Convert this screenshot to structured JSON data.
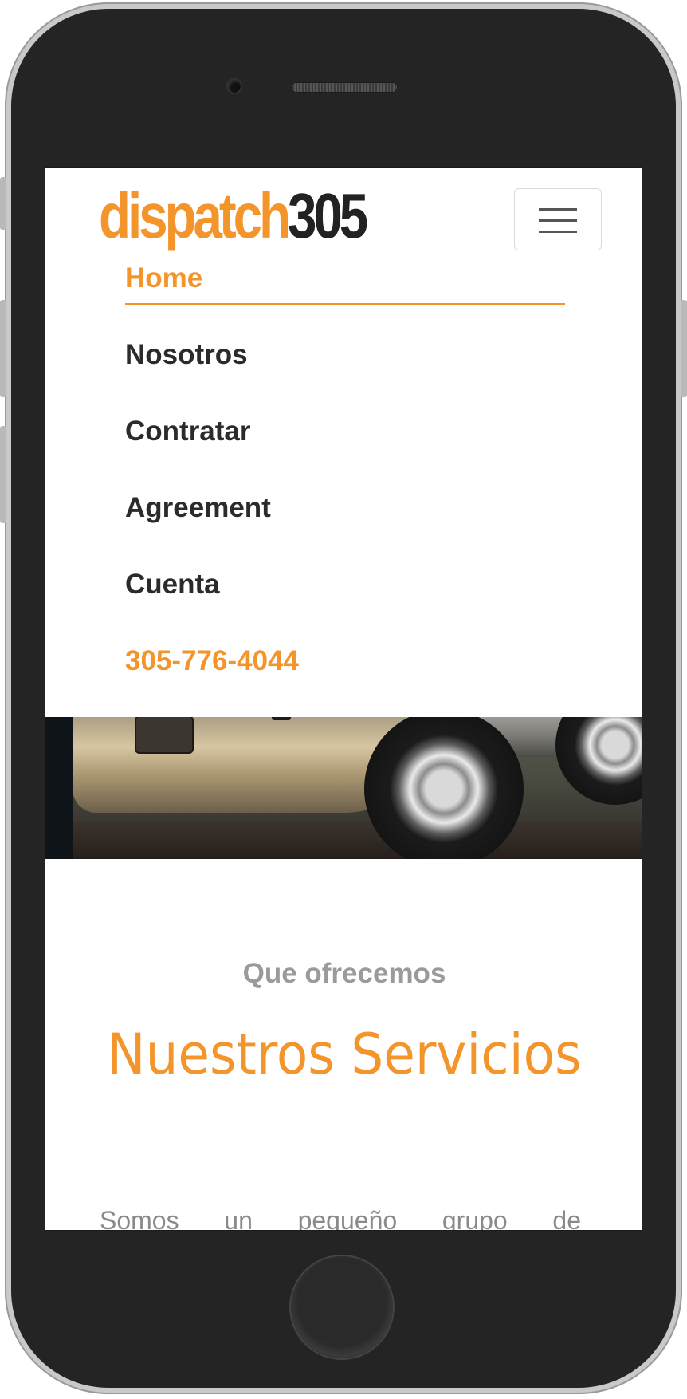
{
  "brand": {
    "logo_part_a": "dispatch",
    "logo_part_b": "305",
    "accent_color": "#f4952c",
    "dark_color": "#222222"
  },
  "navbar": {
    "toggle_icon": "hamburger-menu-icon",
    "items": [
      {
        "label": "Home",
        "active": true
      },
      {
        "label": "Nosotros",
        "active": false
      },
      {
        "label": "Contratar",
        "active": false
      },
      {
        "label": "Agreement",
        "active": false
      },
      {
        "label": "Cuenta",
        "active": false
      }
    ],
    "phone": "305-776-4044"
  },
  "hero": {
    "image": "truck-wheel-photo"
  },
  "services": {
    "kicker": "Que ofrecemos",
    "title": "Nuestros Servicios",
    "intro": "Somos un pequeño grupo de"
  }
}
